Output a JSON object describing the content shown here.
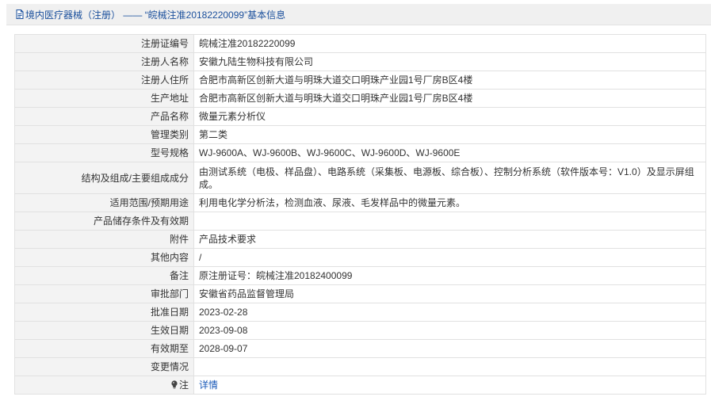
{
  "header": {
    "title": "境内医疗器械（注册） —— “皖械注准20182220099”基本信息",
    "icon": "document-icon",
    "accent_color": "#1a4f9c"
  },
  "rows": [
    {
      "label": "注册证编号",
      "value": "皖械注准20182220099"
    },
    {
      "label": "注册人名称",
      "value": "安徽九陆生物科技有限公司"
    },
    {
      "label": "注册人住所",
      "value": "合肥市高新区创新大道与明珠大道交口明珠产业园1号厂房B区4楼"
    },
    {
      "label": "生产地址",
      "value": "合肥市高新区创新大道与明珠大道交口明珠产业园1号厂房B区4楼"
    },
    {
      "label": "产品名称",
      "value": "微量元素分析仪"
    },
    {
      "label": "管理类别",
      "value": "第二类"
    },
    {
      "label": "型号规格",
      "value": "WJ-9600A、WJ-9600B、WJ-9600C、WJ-9600D、WJ-9600E"
    },
    {
      "label": "结构及组成/主要组成成分",
      "value": "由测试系统（电极、样品盘）、电路系统（采集板、电源板、综合板）、控制分析系统（软件版本号：V1.0）及显示屏组成。"
    },
    {
      "label": "适用范围/预期用途",
      "value": "利用电化学分析法，检测血液、尿液、毛发样品中的微量元素。"
    },
    {
      "label": "产品储存条件及有效期",
      "value": ""
    },
    {
      "label": "附件",
      "value": "产品技术要求"
    },
    {
      "label": "其他内容",
      "value": "/"
    },
    {
      "label": "备注",
      "value": "原注册证号：皖械注准20182400099"
    },
    {
      "label": "审批部门",
      "value": "安徽省药品监督管理局"
    },
    {
      "label": "批准日期",
      "value": "2023-02-28"
    },
    {
      "label": "生效日期",
      "value": "2023-09-08"
    },
    {
      "label": "有效期至",
      "value": "2028-09-07"
    },
    {
      "label": "变更情况",
      "value": ""
    }
  ],
  "note_row": {
    "label": "注",
    "icon": "lightbulb-icon",
    "link_text": "详情"
  }
}
